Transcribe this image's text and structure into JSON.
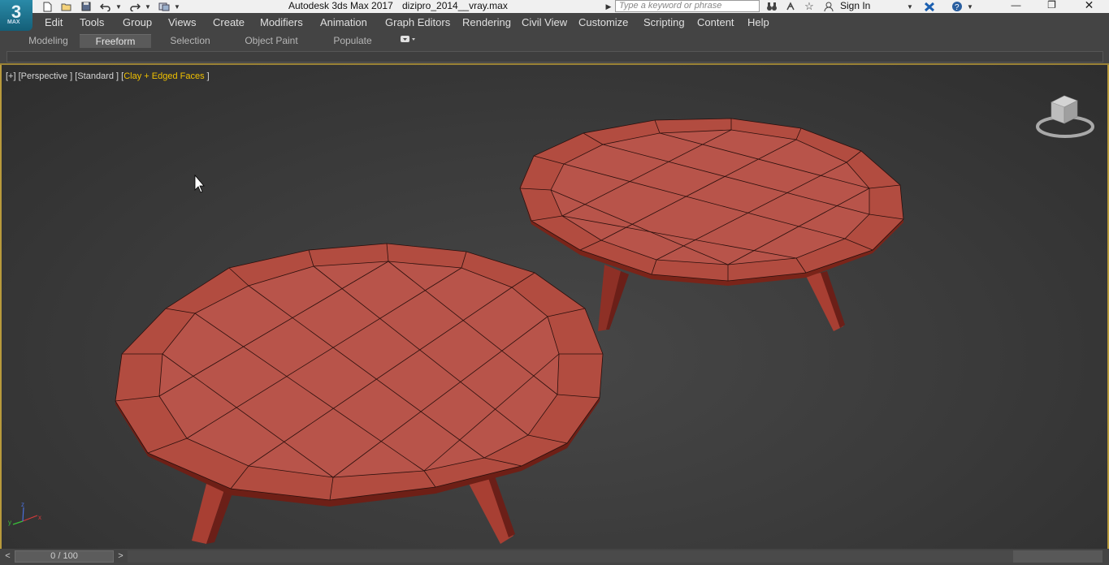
{
  "app": {
    "logo_text": "3",
    "logo_sub": "MAX",
    "title": "Autodesk 3ds Max 2017",
    "filename": "dizipro_2014__vray.max"
  },
  "search": {
    "placeholder": "Type a keyword or phrase"
  },
  "signin": {
    "label": "Sign In"
  },
  "menu": {
    "items": [
      "Edit",
      "Tools",
      "Group",
      "Views",
      "Create",
      "Modifiers",
      "Animation",
      "Graph Editors",
      "Rendering",
      "Civil View",
      "Customize",
      "Scripting",
      "Content",
      "Help"
    ]
  },
  "ribbon": {
    "tabs": [
      "Modeling",
      "Freeform",
      "Selection",
      "Object Paint",
      "Populate"
    ],
    "active": "Freeform"
  },
  "viewport": {
    "label_prefix": "[+] [Perspective ] [Standard ] [",
    "label_highlight": "Clay + Edged Faces",
    "label_suffix": " ]",
    "object_color": "#b24c40"
  },
  "timeline": {
    "frame": "0 / 100",
    "prev": "<",
    "next": ">"
  }
}
